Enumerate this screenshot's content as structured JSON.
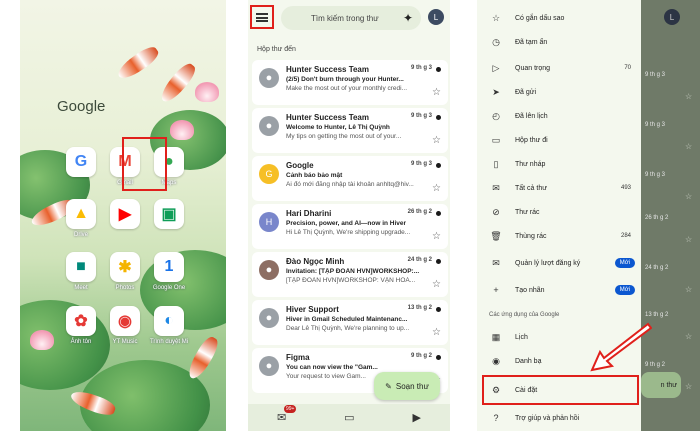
{
  "home": {
    "label": "Google",
    "apps": [
      {
        "label": "",
        "glyph": "G",
        "color": "#4285f4"
      },
      {
        "label": "Gmail",
        "glyph": "M",
        "color": "#ea4335"
      },
      {
        "label": "Maps",
        "glyph": "●",
        "color": "#34a853"
      },
      {
        "label": "Drive",
        "glyph": "▲",
        "color": "#fbbc04"
      },
      {
        "label": "",
        "glyph": "▶",
        "color": "#ff0000"
      },
      {
        "label": "",
        "glyph": "▣",
        "color": "#0f9d58"
      },
      {
        "label": "Meet",
        "glyph": "■",
        "color": "#00897b"
      },
      {
        "label": "Photos",
        "glyph": "✱",
        "color": "#f4b400"
      },
      {
        "label": "Google One",
        "glyph": "1",
        "color": "#1a73e8"
      },
      {
        "label": "Ảnh tôn",
        "glyph": "✿",
        "color": "#e53935"
      },
      {
        "label": "YT Music",
        "glyph": "◉",
        "color": "#e53935"
      },
      {
        "label": "Trình duyệt Mi",
        "glyph": "◐",
        "color": "#1e88e5"
      }
    ]
  },
  "inbox": {
    "search_placeholder": "Tìm kiếm trong thư",
    "avatar_letter": "L",
    "section_title": "Hộp thư đến",
    "mails": [
      {
        "sender": "Hunter Success Team",
        "date": "9 th g 3",
        "subject": "(2/5) Don't burn through your Hunter...",
        "snippet": "Make the most out of your monthly credi...",
        "avatar": "",
        "avatar_color": "#9aa0a6"
      },
      {
        "sender": "Hunter Success Team",
        "date": "9 th g 3",
        "subject": "Welcome to Hunter, Lê Thị Quỳnh",
        "snippet": "My tips on getting the most out of your...",
        "avatar": "",
        "avatar_color": "#9aa0a6"
      },
      {
        "sender": "Google",
        "date": "9 th g 3",
        "subject": "Cảnh báo bảo mật",
        "snippet": "Ai đó mới đăng nhập tài khoản anhltq@hiv...",
        "avatar": "G",
        "avatar_color": "#f6bf26"
      },
      {
        "sender": "Hari Dharini",
        "date": "26 th g 2",
        "subject": "Precision, power, and AI—now in Hiver",
        "snippet": "Hi Lê Thị Quỳnh, We're shipping upgrade...",
        "avatar": "H",
        "avatar_color": "#7986cb"
      },
      {
        "sender": "Đào Ngọc Minh",
        "date": "24 th g 2",
        "subject": "Invitation: [TẬP ĐOÀN HVN]WORKSHOP:...",
        "snippet": "[TẬP ĐOÀN HVN]WORKSHOP: VẬN HOÁ...",
        "avatar": "",
        "avatar_color": "#8d6e63"
      },
      {
        "sender": "Hiver Support",
        "date": "13 th g 2",
        "subject": "Hiver in Gmail Scheduled Maintenanc...",
        "snippet": "Dear Lê Thị Quỳnh, We're planning to up...",
        "avatar": "",
        "avatar_color": "#9aa0a6"
      },
      {
        "sender": "Figma",
        "date": "9 th g 2",
        "subject": "You can now view the \"Gam...",
        "snippet": "Your request to view Gam...",
        "avatar": "",
        "avatar_color": "#9aa0a6"
      }
    ],
    "compose_label": "Soạn thư",
    "mail_badge": "99+"
  },
  "drawer": {
    "items": [
      {
        "label": "Có gắn dấu sao",
        "icon": "☆",
        "count": ""
      },
      {
        "label": "Đã tạm ẩn",
        "icon": "◷",
        "count": ""
      },
      {
        "label": "Quan trọng",
        "icon": "▷",
        "count": "70"
      },
      {
        "label": "Đã gửi",
        "icon": "➤",
        "count": ""
      },
      {
        "label": "Đã lên lịch",
        "icon": "◴",
        "count": ""
      },
      {
        "label": "Hộp thư đi",
        "icon": "▭",
        "count": ""
      },
      {
        "label": "Thư nháp",
        "icon": "▯",
        "count": ""
      },
      {
        "label": "Tất cả thư",
        "icon": "✉",
        "count": "493"
      },
      {
        "label": "Thư rác",
        "icon": "⊘",
        "count": ""
      },
      {
        "label": "Thùng rác",
        "icon": "🗑",
        "count": "284"
      },
      {
        "label": "Quản lý lượt đăng ký",
        "icon": "✉",
        "count": "",
        "badge": "Mới"
      },
      {
        "label": "Tạo nhãn",
        "icon": "+",
        "count": "",
        "badge": "Mới"
      }
    ],
    "section": "Các ứng dụng của Google",
    "apps": [
      {
        "label": "Lịch",
        "icon": "▦"
      },
      {
        "label": "Danh bạ",
        "icon": "◉"
      }
    ],
    "settings": {
      "label": "Cài đặt",
      "icon": "⚙"
    },
    "help": {
      "label": "Trợ giúp và phản hồi",
      "icon": "?"
    },
    "scrim_dates": [
      "9 th g 3",
      "9 th g 3",
      "9 th g 3",
      "26 th g 2",
      "24 th g 2",
      "13 th g 2",
      "9 th g 2"
    ],
    "scrim_compose": "n thư",
    "scrim_avatar": "L"
  },
  "colors": {
    "highlight": "#e0201b",
    "badge_blue": "#0b57d0",
    "compose_green": "#c9ecb5"
  }
}
